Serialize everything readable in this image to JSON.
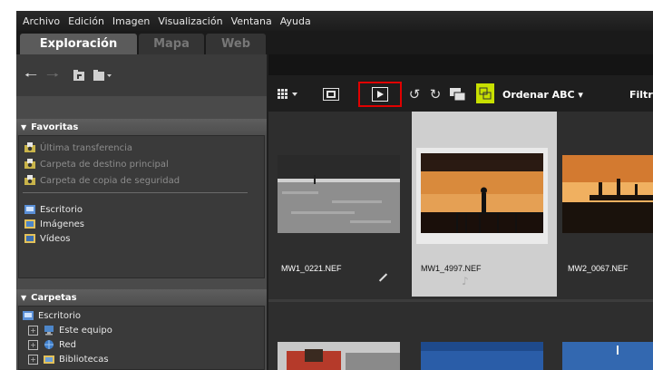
{
  "menu": [
    "Archivo",
    "Edición",
    "Imagen",
    "Visualización",
    "Ventana",
    "Ayuda"
  ],
  "tabs": [
    {
      "label": "Exploración",
      "active": true
    },
    {
      "label": "Mapa",
      "active": false
    },
    {
      "label": "Web",
      "active": false
    }
  ],
  "left": {
    "favorites_header": "Favoritas",
    "favorites": [
      {
        "label": "Última transferencia",
        "icon": "camera-folder-icon"
      },
      {
        "label": "Carpeta de destino principal",
        "icon": "camera-folder-icon"
      },
      {
        "label": "Carpeta de copia de seguridad",
        "icon": "camera-folder-icon"
      }
    ],
    "places": [
      {
        "label": "Escritorio",
        "icon": "desktop-folder-icon"
      },
      {
        "label": "Imágenes",
        "icon": "pictures-folder-icon"
      },
      {
        "label": "Vídeos",
        "icon": "videos-folder-icon"
      }
    ],
    "folders_header": "Carpetas",
    "folders_root": "Escritorio",
    "folders": [
      {
        "label": "Este equipo",
        "icon": "computer-icon"
      },
      {
        "label": "Red",
        "icon": "network-icon"
      },
      {
        "label": "Bibliotecas",
        "icon": "libraries-icon"
      }
    ]
  },
  "toolbar": {
    "sort_label": "Ordenar ABC ▾",
    "filter_label": "Filtro"
  },
  "thumbnails": [
    {
      "filename": "MW1_0221.NEF",
      "selected": false
    },
    {
      "filename": "MW1_4997.NEF",
      "selected": true
    },
    {
      "filename": "MW2_0067.NEF",
      "selected": false
    }
  ],
  "colors": {
    "selection_highlight": "#e00000",
    "selected_cell": "#cfcfcf",
    "toggle_green": "#c8e000"
  }
}
